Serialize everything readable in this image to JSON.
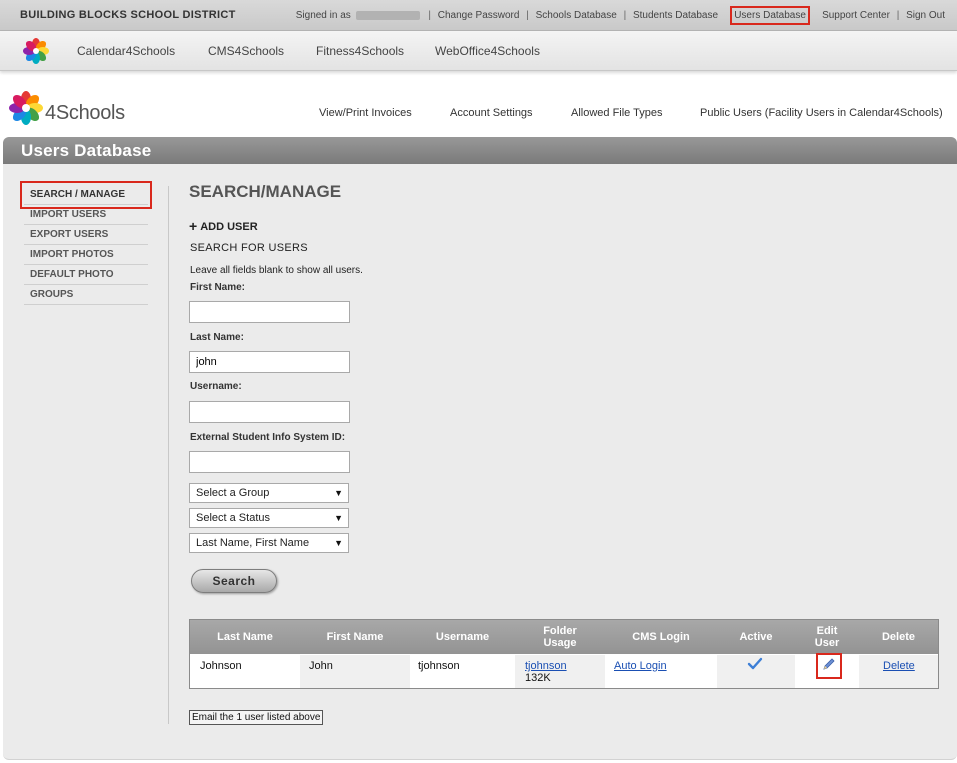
{
  "topbar": {
    "district": "BUILDING BLOCKS SCHOOL DISTRICT",
    "signed_in_as": "Signed in as",
    "links": {
      "change_password": "Change Password",
      "schools_database": "Schools Database",
      "students_database": "Students Database",
      "users_database": "Users Database",
      "support_center": "Support Center",
      "sign_out": "Sign Out"
    },
    "separator": "|"
  },
  "products": {
    "items": [
      "Calendar4Schools",
      "CMS4Schools",
      "Fitness4Schools",
      "WebOffice4Schools"
    ]
  },
  "brand": {
    "name": "4Schools"
  },
  "nav": {
    "items": [
      "View/Print Invoices",
      "Account Settings",
      "Allowed File Types",
      "Public Users (Facility Users in Calendar4Schools)"
    ]
  },
  "section": {
    "title": "Users Database"
  },
  "sidebar": {
    "items": [
      {
        "label": "SEARCH / MANAGE"
      },
      {
        "label": "IMPORT USERS"
      },
      {
        "label": "EXPORT USERS"
      },
      {
        "label": "IMPORT PHOTOS"
      },
      {
        "label": "DEFAULT PHOTO"
      },
      {
        "label": "GROUPS"
      }
    ]
  },
  "content": {
    "title": "SEARCH/MANAGE",
    "add_user": "ADD USER",
    "add_icon": "+",
    "search_for": "SEARCH FOR USERS",
    "hint": "Leave all fields blank to show all users.",
    "fields": {
      "first_name": {
        "label": "First Name:",
        "value": ""
      },
      "last_name": {
        "label": "Last Name:",
        "value": "john"
      },
      "username": {
        "label": "Username:",
        "value": ""
      },
      "external_id": {
        "label": "External Student Info System ID:",
        "value": ""
      }
    },
    "selects": {
      "group": "Select a Group",
      "status": "Select a Status",
      "sort": "Last Name, First Name"
    },
    "search_button": "Search",
    "email_button": "Email the 1 user listed above"
  },
  "table": {
    "headers": {
      "last_name": "Last Name",
      "first_name": "First Name",
      "username": "Username",
      "folder_usage_1": "Folder",
      "folder_usage_2": "Usage",
      "cms_login": "CMS Login",
      "active": "Active",
      "edit_user_1": "Edit",
      "edit_user_2": "User",
      "delete": "Delete"
    },
    "rows": [
      {
        "last_name": "Johnson",
        "first_name": "John",
        "username": "tjohnson",
        "folder_link": "tjohnson",
        "folder_size": "132K",
        "cms_login": "Auto Login",
        "active": true,
        "delete": "Delete"
      }
    ]
  },
  "colors": {
    "highlight": "#d9281c",
    "header_gray": "#8a8a8a",
    "link_blue": "#1a4fb3",
    "check_blue": "#3d7fd6"
  },
  "icons": {
    "logo": "flower-logo-icon",
    "plus": "plus-icon",
    "dropdown": "triangle-down-icon",
    "active": "checkmark-icon",
    "edit": "pencil-icon"
  }
}
